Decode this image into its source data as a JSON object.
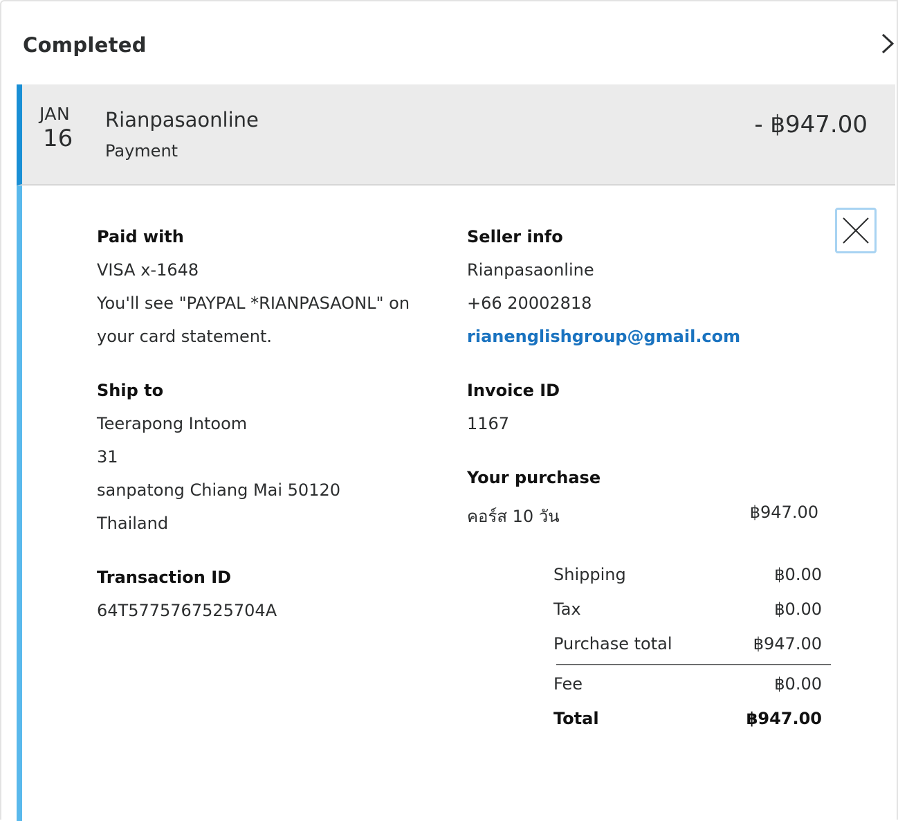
{
  "section": {
    "title": "Completed"
  },
  "transaction": {
    "month": "JAN",
    "day": "16",
    "merchant": "Rianpasaonline",
    "type": "Payment",
    "amount": "- ฿947.00"
  },
  "paid_with": {
    "heading": "Paid with",
    "card": "VISA x-1648",
    "note_line1": "You'll see \"PAYPAL *RIANPASAONL\" on",
    "note_line2": "your card statement."
  },
  "seller": {
    "heading": "Seller info",
    "name": "Rianpasaonline",
    "phone": "+66 20002818",
    "email": "rianenglishgroup@gmail.com"
  },
  "ship_to": {
    "heading": "Ship to",
    "name": "Teerapong Intoom",
    "line1": "31",
    "line2": "sanpatong Chiang Mai 50120",
    "country": "Thailand"
  },
  "invoice": {
    "heading": "Invoice ID",
    "id": "1167"
  },
  "purchase": {
    "heading": "Your purchase",
    "item": "คอร์ส 10 วัน",
    "item_amount": "฿947.00"
  },
  "transaction_id": {
    "heading": "Transaction ID",
    "id": "64T5775767525704A"
  },
  "summary": {
    "shipping_label": "Shipping",
    "shipping_value": "฿0.00",
    "tax_label": "Tax",
    "tax_value": "฿0.00",
    "purchase_total_label": "Purchase total",
    "purchase_total_value": "฿947.00",
    "fee_label": "Fee",
    "fee_value": "฿0.00",
    "total_label": "Total",
    "total_value": "฿947.00"
  },
  "colors": {
    "accent": "#1a8fd5",
    "link": "#1a73c0",
    "expanded_bar": "#5ab9ec"
  },
  "icons": {
    "expand": "chevron-right-icon",
    "close": "close-icon"
  }
}
